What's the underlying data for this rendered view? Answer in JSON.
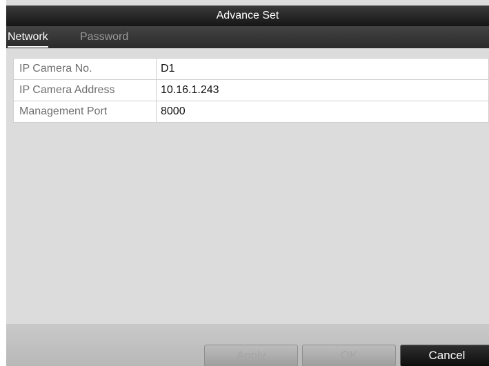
{
  "window": {
    "title": "Advance Set"
  },
  "tabs": [
    {
      "label": "Network",
      "active": true
    },
    {
      "label": "Password",
      "active": false
    }
  ],
  "fields": [
    {
      "label": "IP Camera No.",
      "value": "D1"
    },
    {
      "label": "IP Camera Address",
      "value": "10.16.1.243"
    },
    {
      "label": "Management Port",
      "value": "8000"
    }
  ],
  "buttons": {
    "apply": {
      "label": "Apply",
      "enabled": false
    },
    "ok": {
      "label": "OK",
      "enabled": false
    },
    "cancel": {
      "label": "Cancel",
      "enabled": true
    }
  },
  "colors": {
    "title_bar": "#222222",
    "panel_background": "#dcdcdc",
    "active_tab_text": "#ffffff",
    "inactive_tab_text": "#9a9a9a"
  }
}
